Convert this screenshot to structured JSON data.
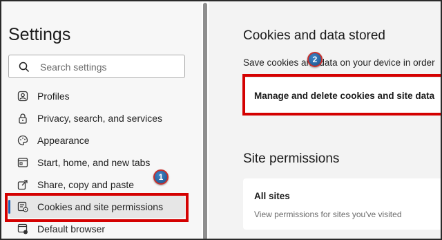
{
  "sidebar": {
    "title": "Settings",
    "search_placeholder": "Search settings",
    "items": [
      {
        "label": "Profiles",
        "icon": "profile-icon"
      },
      {
        "label": "Privacy, search, and services",
        "icon": "lock-icon"
      },
      {
        "label": "Appearance",
        "icon": "palette-icon"
      },
      {
        "label": "Start, home, and new tabs",
        "icon": "home-tabs-icon"
      },
      {
        "label": "Share, copy and paste",
        "icon": "share-icon"
      },
      {
        "label": "Cookies and site permissions",
        "icon": "cookies-permissions-icon",
        "active": true
      },
      {
        "label": "Default browser",
        "icon": "browser-icon"
      }
    ]
  },
  "main": {
    "cookies_title": "Cookies and data stored",
    "cookies_desc": "Save cookies and data on your device in order",
    "manage_label": "Manage and delete cookies and site data",
    "permissions_title": "Site permissions",
    "all_sites_title": "All sites",
    "all_sites_sub": "View permissions for sites you've visited"
  },
  "annotations": {
    "badge1": "1",
    "badge2": "2",
    "highlight_color": "#d40000"
  },
  "colors": {
    "accent": "#1a5fb4",
    "badge_fill": "#2f6aa8"
  }
}
